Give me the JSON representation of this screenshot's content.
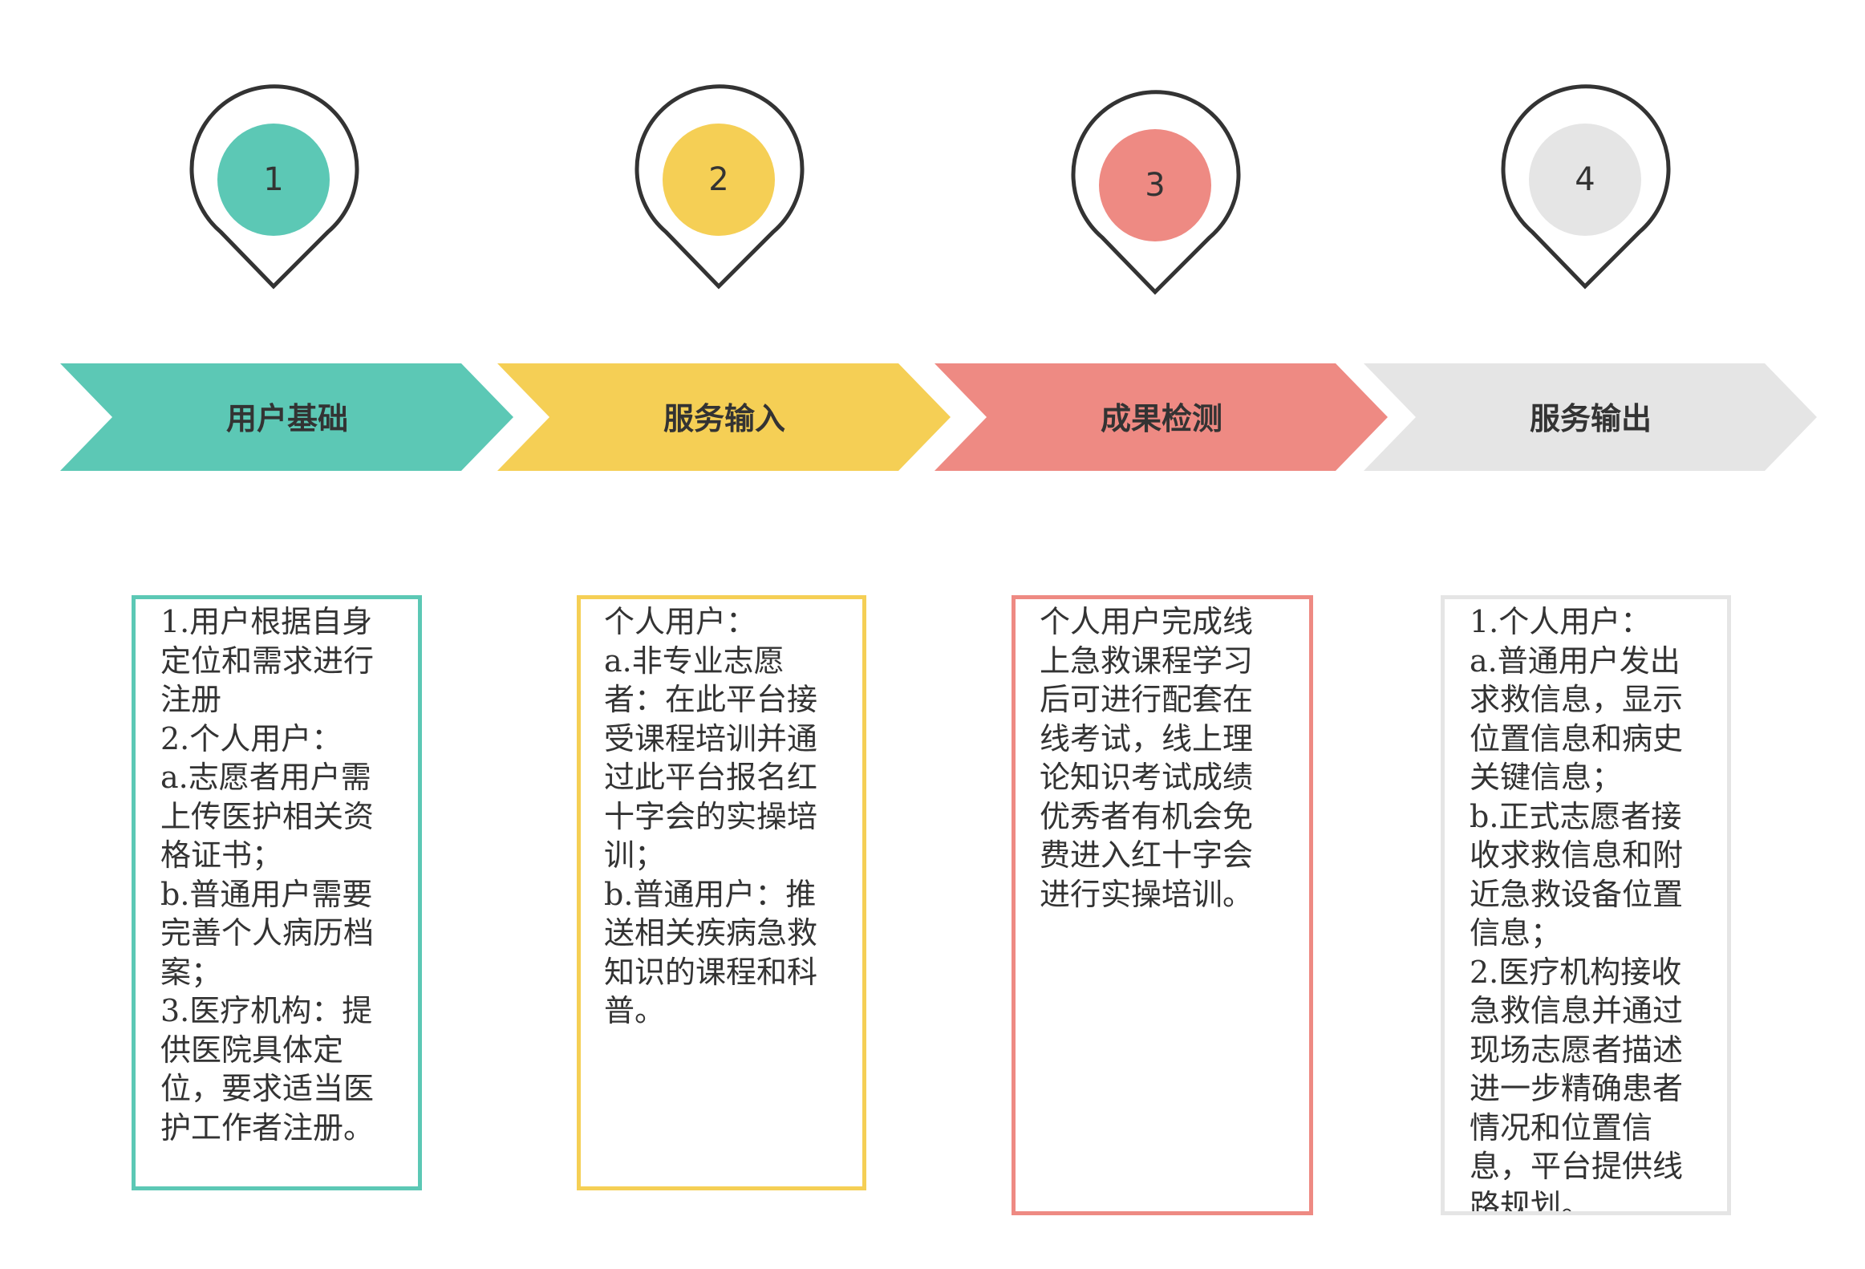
{
  "theme": {
    "teal": "#5cc8b5",
    "yellow": "#f5cf55",
    "coral": "#ee8a83",
    "gray": "#e5e5e5",
    "outline": "#333333"
  },
  "steps": [
    {
      "number": "1",
      "label": "用户基础",
      "color": "#5cc8b5",
      "text": "1.用户根据自身定位和需求进行注册\n2.个人用户：\na.志愿者用户需上传医护相关资格证书；\nb.普通用户需要完善个人病历档案；\n3.医疗机构：提供医院具体定位，要求适当医护工作者注册。"
    },
    {
      "number": "2",
      "label": "服务输入",
      "color": "#f5cf55",
      "text": "个人用户：\na.非专业志愿者：在此平台接受课程培训并通过此平台报名红十字会的实操培训；\nb.普通用户：推送相关疾病急救知识的课程和科普。"
    },
    {
      "number": "3",
      "label": "成果检测",
      "color": "#ee8a83",
      "text": "个人用户完成线上急救课程学习后可进行配套在线考试，线上理论知识考试成绩优秀者有机会免费进入红十字会进行实操培训。"
    },
    {
      "number": "4",
      "label": "服务输出",
      "color": "#e5e5e5",
      "text": "1.个人用户：\na.普通用户发出求救信息，显示位置信息和病史关键信息；\nb.正式志愿者接收求救信息和附近急救设备位置信息；\n2.医疗机构接收急救信息并通过现场志愿者描述进一步精确患者情况和位置信息，平台提供线路规划。"
    }
  ]
}
